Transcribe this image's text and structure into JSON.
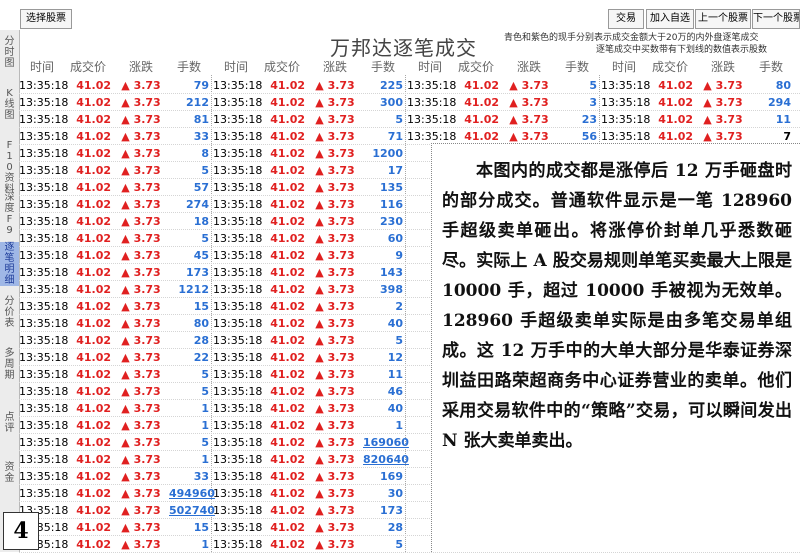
{
  "toolbar": {
    "select_stock": "选择股票",
    "trade": "交易",
    "add_watch": "加入自选",
    "prev_stock": "上一个股票",
    "next_stock": "下一个股票"
  },
  "title": "万邦达逐笔成交",
  "legend": {
    "line1": "青色和紫色的现手分别表示成交金额大于20万的内外盘逐笔成交",
    "line2": "逐笔成交中买数带有下划线的数值表示股数"
  },
  "sidebar": {
    "items": [
      {
        "label": "分时图"
      },
      {
        "label": "K线图"
      },
      {
        "label": "F10资料"
      },
      {
        "label": "深度F9"
      },
      {
        "label": "逐笔明细"
      },
      {
        "label": "分价表"
      },
      {
        "label": "多周期"
      },
      {
        "label": "点评"
      },
      {
        "label": "资金"
      }
    ]
  },
  "columns": [
    "时间",
    "成交价",
    "涨跌",
    "手数"
  ],
  "colors": {
    "up": "#e02020",
    "volume": "#2a6fd3",
    "active_tab": "#9fb7e6"
  },
  "trades": [
    [
      [
        "13:35:18",
        "41.02",
        "▲ 3.73",
        "79"
      ],
      [
        "13:35:18",
        "41.02",
        "▲ 3.73",
        "225"
      ],
      [
        "13:35:18",
        "41.02",
        "▲ 3.73",
        "5"
      ],
      [
        "13:35:18",
        "41.02",
        "▲ 3.73",
        "80"
      ]
    ],
    [
      [
        "13:35:18",
        "41.02",
        "▲ 3.73",
        "212"
      ],
      [
        "13:35:18",
        "41.02",
        "▲ 3.73",
        "300"
      ],
      [
        "13:35:18",
        "41.02",
        "▲ 3.73",
        "3"
      ],
      [
        "13:35:18",
        "41.02",
        "▲ 3.73",
        "294"
      ]
    ],
    [
      [
        "13:35:18",
        "41.02",
        "▲ 3.73",
        "81"
      ],
      [
        "13:35:18",
        "41.02",
        "▲ 3.73",
        "5"
      ],
      [
        "13:35:18",
        "41.02",
        "▲ 3.73",
        "23"
      ],
      [
        "13:35:18",
        "41.02",
        "▲ 3.73",
        "11"
      ]
    ],
    [
      [
        "13:35:18",
        "41.02",
        "▲ 3.73",
        "33"
      ],
      [
        "13:35:18",
        "41.02",
        "▲ 3.73",
        "71"
      ],
      [
        "13:35:18",
        "41.02",
        "▲ 3.73",
        "56"
      ],
      [
        "13:35:18",
        "41.02",
        "▲ 3.73",
        "7"
      ]
    ],
    [
      [
        "13:35:18",
        "41.02",
        "▲ 3.73",
        "8"
      ],
      [
        "13:35:18",
        "41.02",
        "▲ 3.73",
        "1200"
      ]
    ],
    [
      [
        "13:35:18",
        "41.02",
        "▲ 3.73",
        "5"
      ],
      [
        "13:35:18",
        "41.02",
        "▲ 3.73",
        "17"
      ]
    ],
    [
      [
        "13:35:18",
        "41.02",
        "▲ 3.73",
        "57"
      ],
      [
        "13:35:18",
        "41.02",
        "▲ 3.73",
        "135"
      ]
    ],
    [
      [
        "13:35:18",
        "41.02",
        "▲ 3.73",
        "274"
      ],
      [
        "13:35:18",
        "41.02",
        "▲ 3.73",
        "116"
      ]
    ],
    [
      [
        "13:35:18",
        "41.02",
        "▲ 3.73",
        "18"
      ],
      [
        "13:35:18",
        "41.02",
        "▲ 3.73",
        "230"
      ]
    ],
    [
      [
        "13:35:18",
        "41.02",
        "▲ 3.73",
        "5"
      ],
      [
        "13:35:18",
        "41.02",
        "▲ 3.73",
        "60"
      ]
    ],
    [
      [
        "13:35:18",
        "41.02",
        "▲ 3.73",
        "45"
      ],
      [
        "13:35:18",
        "41.02",
        "▲ 3.73",
        "9"
      ]
    ],
    [
      [
        "13:35:18",
        "41.02",
        "▲ 3.73",
        "173"
      ],
      [
        "13:35:18",
        "41.02",
        "▲ 3.73",
        "143"
      ]
    ],
    [
      [
        "13:35:18",
        "41.02",
        "▲ 3.73",
        "1212"
      ],
      [
        "13:35:18",
        "41.02",
        "▲ 3.73",
        "398"
      ]
    ],
    [
      [
        "13:35:18",
        "41.02",
        "▲ 3.73",
        "15"
      ],
      [
        "13:35:18",
        "41.02",
        "▲ 3.73",
        "2"
      ]
    ],
    [
      [
        "13:35:18",
        "41.02",
        "▲ 3.73",
        "80"
      ],
      [
        "13:35:18",
        "41.02",
        "▲ 3.73",
        "40"
      ]
    ],
    [
      [
        "13:35:18",
        "41.02",
        "▲ 3.73",
        "28"
      ],
      [
        "13:35:18",
        "41.02",
        "▲ 3.73",
        "5"
      ]
    ],
    [
      [
        "13:35:18",
        "41.02",
        "▲ 3.73",
        "22"
      ],
      [
        "13:35:18",
        "41.02",
        "▲ 3.73",
        "12"
      ]
    ],
    [
      [
        "13:35:18",
        "41.02",
        "▲ 3.73",
        "5"
      ],
      [
        "13:35:18",
        "41.02",
        "▲ 3.73",
        "11"
      ]
    ],
    [
      [
        "13:35:18",
        "41.02",
        "▲ 3.73",
        "5"
      ],
      [
        "13:35:18",
        "41.02",
        "▲ 3.73",
        "46"
      ]
    ],
    [
      [
        "13:35:18",
        "41.02",
        "▲ 3.73",
        "1"
      ],
      [
        "13:35:18",
        "41.02",
        "▲ 3.73",
        "40"
      ]
    ],
    [
      [
        "13:35:18",
        "41.02",
        "▲ 3.73",
        "1"
      ],
      [
        "13:35:18",
        "41.02",
        "▲ 3.73",
        "1"
      ]
    ],
    [
      [
        "13:35:18",
        "41.02",
        "▲ 3.73",
        "5"
      ],
      [
        "13:35:18",
        "41.02",
        "▲ 3.73",
        "169060"
      ]
    ],
    [
      [
        "13:35:18",
        "41.02",
        "▲ 3.73",
        "1"
      ],
      [
        "13:35:18",
        "41.02",
        "▲ 3.73",
        "820640"
      ]
    ],
    [
      [
        "13:35:18",
        "41.02",
        "▲ 3.73",
        "33"
      ],
      [
        "13:35:18",
        "41.02",
        "▲ 3.73",
        "169"
      ]
    ],
    [
      [
        "13:35:18",
        "41.02",
        "▲ 3.73",
        "494960"
      ],
      [
        "13:35:18",
        "41.02",
        "▲ 3.73",
        "30"
      ]
    ],
    [
      [
        "13:35:18",
        "41.02",
        "▲ 3.73",
        "502740"
      ],
      [
        "13:35:18",
        "41.02",
        "▲ 3.73",
        "173"
      ]
    ],
    [
      [
        "13:35:18",
        "41.02",
        "▲ 3.73",
        "15"
      ],
      [
        "13:35:18",
        "41.02",
        "▲ 3.73",
        "28"
      ]
    ],
    [
      [
        "13:35:18",
        "41.02",
        "▲ 3.73",
        "1"
      ],
      [
        "13:35:18",
        "41.02",
        "▲ 3.73",
        "5"
      ]
    ]
  ],
  "note": {
    "text": "本图内的成交都是涨停后 12 万手砸盘时的部分成交。普通软件显示是一笔 128960 手超级卖单砸出。将涨停价封单几乎悉数砸尽。实际上 A 股交易规则单笔买卖最大上限是 10000 手，超过 10000 手被视为无效单。128960 手超级卖单实际是由多笔交易单组成。这 12 万手中的大单大部分是华泰证券深圳益田路荣超商务中心证券营业的卖单。他们采用交易软件中的“策略”交易，可以瞬间发出 N 张大卖单卖出。"
  },
  "figure_number": "4"
}
